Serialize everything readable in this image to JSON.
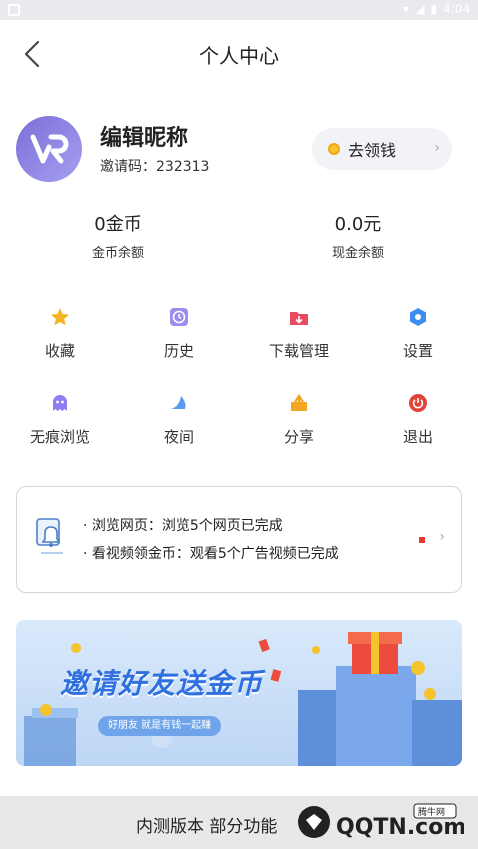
{
  "statusbar": {
    "time": "4:04"
  },
  "header": {
    "title": "个人中心"
  },
  "profile": {
    "nickname": "编辑昵称",
    "invite_code": "邀请码：232313",
    "earn_button": "去领钱"
  },
  "balances": {
    "coins_value": "0金币",
    "coins_label": "金币余额",
    "cash_value": "0.0元",
    "cash_label": "现金余额"
  },
  "menu": {
    "favorites": "收藏",
    "history": "历史",
    "downloads": "下载管理",
    "settings": "设置",
    "incognito": "无痕浏览",
    "night": "夜间",
    "share": "分享",
    "logout": "退出"
  },
  "tasks": {
    "line1": "· 浏览网页：浏览5个网页已完成",
    "line2": "· 看视频领金币：观看5个广告视频已完成"
  },
  "banner": {
    "title": "邀请好友送金币",
    "pill": "好朋友 就是有钱一起赚"
  },
  "bottom": {
    "notice": "内测版本 部分功能"
  },
  "watermark": {
    "text": "QQTN.com",
    "tag": "腾牛网"
  },
  "colors": {
    "accent_purple": "#8a7fe0",
    "coin_gold": "#f5c32c",
    "banner_blue": "#2f6fe0",
    "logout_red": "#e0453a"
  }
}
